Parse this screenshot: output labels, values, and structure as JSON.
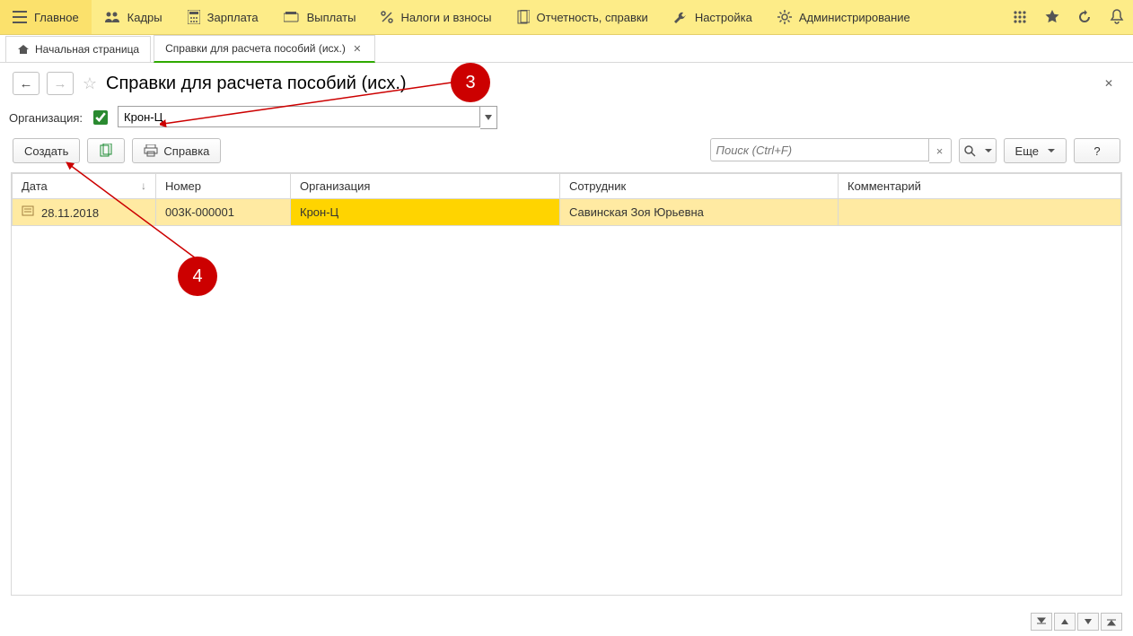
{
  "mainmenu": {
    "items": [
      {
        "label": "Главное"
      },
      {
        "label": "Кадры"
      },
      {
        "label": "Зарплата"
      },
      {
        "label": "Выплаты"
      },
      {
        "label": "Налоги и взносы"
      },
      {
        "label": "Отчетность, справки"
      },
      {
        "label": "Настройка"
      },
      {
        "label": "Администрирование"
      }
    ]
  },
  "tabs": {
    "home_label": "Начальная страница",
    "active_label": "Справки для расчета пособий (исх.)"
  },
  "page": {
    "title": "Справки для расчета пособий (исх.)"
  },
  "filter": {
    "label": "Организация:",
    "value": "Крон-Ц"
  },
  "toolbar": {
    "create": "Создать",
    "report": "Справка",
    "search_placeholder": "Поиск (Ctrl+F)",
    "more": "Еще",
    "help": "?"
  },
  "columns": {
    "date": "Дата",
    "number": "Номер",
    "org": "Организация",
    "employee": "Сотрудник",
    "comment": "Комментарий"
  },
  "rows": [
    {
      "date": "28.11.2018",
      "number": "003К-000001",
      "org": "Крон-Ц",
      "employee": "Савинская Зоя Юрьевна",
      "comment": ""
    }
  ],
  "callouts": {
    "c3": "3",
    "c4": "4"
  }
}
